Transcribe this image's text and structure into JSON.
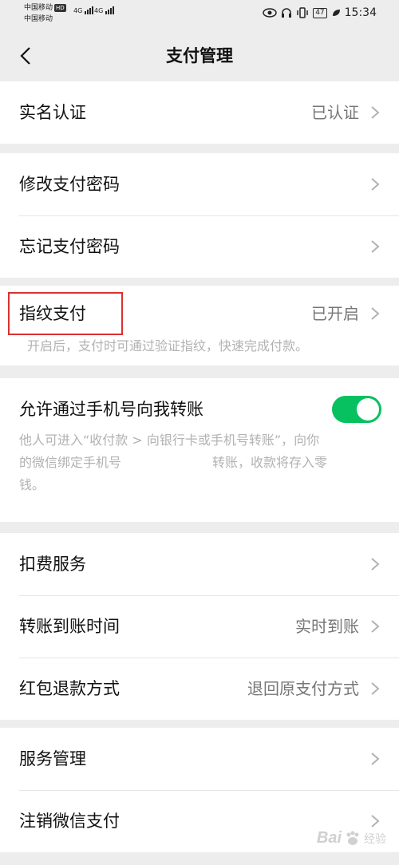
{
  "status_bar": {
    "carrier1": "中国移动",
    "hd": "HD",
    "carrier2": "中国移动",
    "network1": "4G",
    "network2": "4G",
    "battery": "47",
    "time": "15:34"
  },
  "nav": {
    "title": "支付管理",
    "back_icon": "chevron-left-icon"
  },
  "groups": {
    "identity": {
      "label": "实名认证",
      "value": "已认证"
    },
    "password": {
      "change_label": "修改支付密码",
      "forgot_label": "忘记支付密码"
    },
    "fingerprint": {
      "label": "指纹支付",
      "value": "已开启",
      "desc": "开启后，支付时可通过验证指纹，快速完成付款。",
      "highlight_color": "#d9312f"
    },
    "phone_transfer": {
      "label": "允许通过手机号向我转账",
      "toggle_on": true,
      "toggle_color": "#07c160",
      "desc_line1": "他人可进入“收付款 > 向银行卡或手机号转账”，向你",
      "desc_line2a": "的微信绑定手机号",
      "desc_line2b": "转账，收款将存入零",
      "desc_line3": "钱。"
    },
    "services": {
      "deduction_label": "扣费服务",
      "arrival_label": "转账到账时间",
      "arrival_value": "实时到账",
      "refund_label": "红包退款方式",
      "refund_value": "退回原支付方式"
    },
    "manage": {
      "service_label": "服务管理",
      "cancel_label": "注销微信支付"
    }
  },
  "watermark": {
    "text": "Bai",
    "sub": "经验"
  }
}
